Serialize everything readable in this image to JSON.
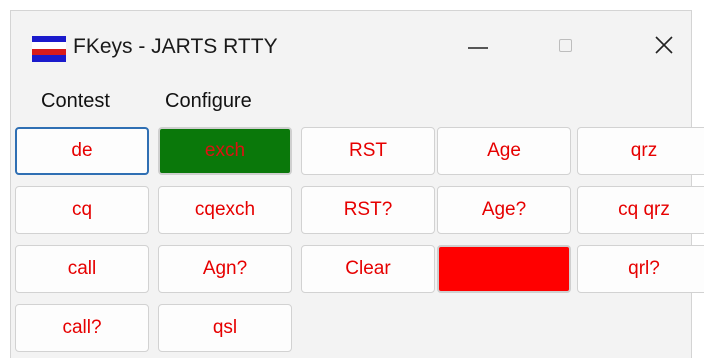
{
  "window": {
    "title": "FKeys - JARTS RTTY",
    "minimize_glyph": "minimize-icon",
    "maximize_glyph": "maximize-icon",
    "close_glyph": "close-icon"
  },
  "menu": {
    "items": [
      "Contest",
      "Configure"
    ]
  },
  "colors": {
    "button_text": "#e60000",
    "green_button": "#0a780a",
    "red_button": "#ff0000",
    "focus_border": "#2f6fb3"
  },
  "fkeys": [
    [
      "de",
      "exch",
      "RST",
      "Age",
      "qrz"
    ],
    [
      "cq",
      "cqexch",
      "RST?",
      "Age?",
      "cq qrz"
    ],
    [
      "call",
      "Agn?",
      "Clear",
      "",
      "qrl?"
    ],
    [
      "call?",
      "qsl"
    ]
  ]
}
